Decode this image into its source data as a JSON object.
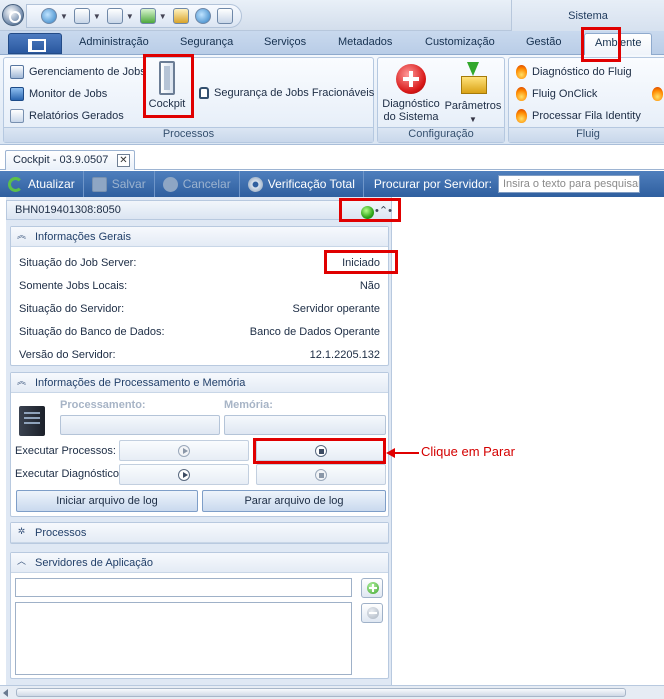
{
  "ribbon": {
    "context_group": "Sistema",
    "tabs": [
      "Administração",
      "Segurança",
      "Serviços",
      "Metadados",
      "Customização",
      "Gestão",
      "Ambiente"
    ],
    "groups": {
      "processos": {
        "label": "Processos",
        "items": [
          "Gerenciamento de Jobs",
          "Monitor de Jobs",
          "Relatórios Gerados"
        ],
        "cockpit": "Cockpit",
        "security_jobs": "Segurança de Jobs Fracionáveis"
      },
      "configuracao": {
        "label": "Configuração",
        "diagnostico_line1": "Diagnóstico",
        "diagnostico_line2": "do Sistema",
        "parametros": "Parâmetros"
      },
      "fluig": {
        "label": "Fluig",
        "items": [
          "Diagnóstico do Fluig",
          "Fluig OnClick",
          "Processar Fila Identity"
        ]
      }
    }
  },
  "document_tab": {
    "title": "Cockpit - 03.9.0507",
    "close": "✕"
  },
  "toolbar": {
    "atualizar": "Atualizar",
    "salvar": "Salvar",
    "cancelar": "Cancelar",
    "verificacao": "Verificação Total",
    "search_label": "Procurar por Servidor:",
    "search_placeholder": "Insira o texto para pesquisar"
  },
  "server": {
    "name": "BHN019401308:8050",
    "status_color": "#2fa51a"
  },
  "info_gerais": {
    "title": "Informações Gerais",
    "rows": [
      {
        "label": "Situação do Job Server:",
        "value": "Iniciado"
      },
      {
        "label": "Somente Jobs Locais:",
        "value": "Não"
      },
      {
        "label": "Situação do Servidor:",
        "value": "Servidor operante"
      },
      {
        "label": "Situação do Banco de Dados:",
        "value": "Banco de Dados Operante"
      },
      {
        "label": "Versão do Servidor:",
        "value": "12.1.2205.132"
      }
    ]
  },
  "processamento": {
    "title": "Informações de Processamento e Memória",
    "processamento_label": "Processamento:",
    "memoria_label": "Memória:",
    "executar_processos": "Executar Processos:",
    "executar_diagnostico": "Executar Diagnóstico:",
    "iniciar_log": "Iniciar arquivo de log",
    "parar_log": "Parar arquivo de log"
  },
  "processos_section": {
    "title": "Processos"
  },
  "servidores_aplicacao": {
    "title": "Servidores de Aplicação"
  },
  "annotation": {
    "text": "Clique em Parar",
    "color": "#e00000"
  }
}
